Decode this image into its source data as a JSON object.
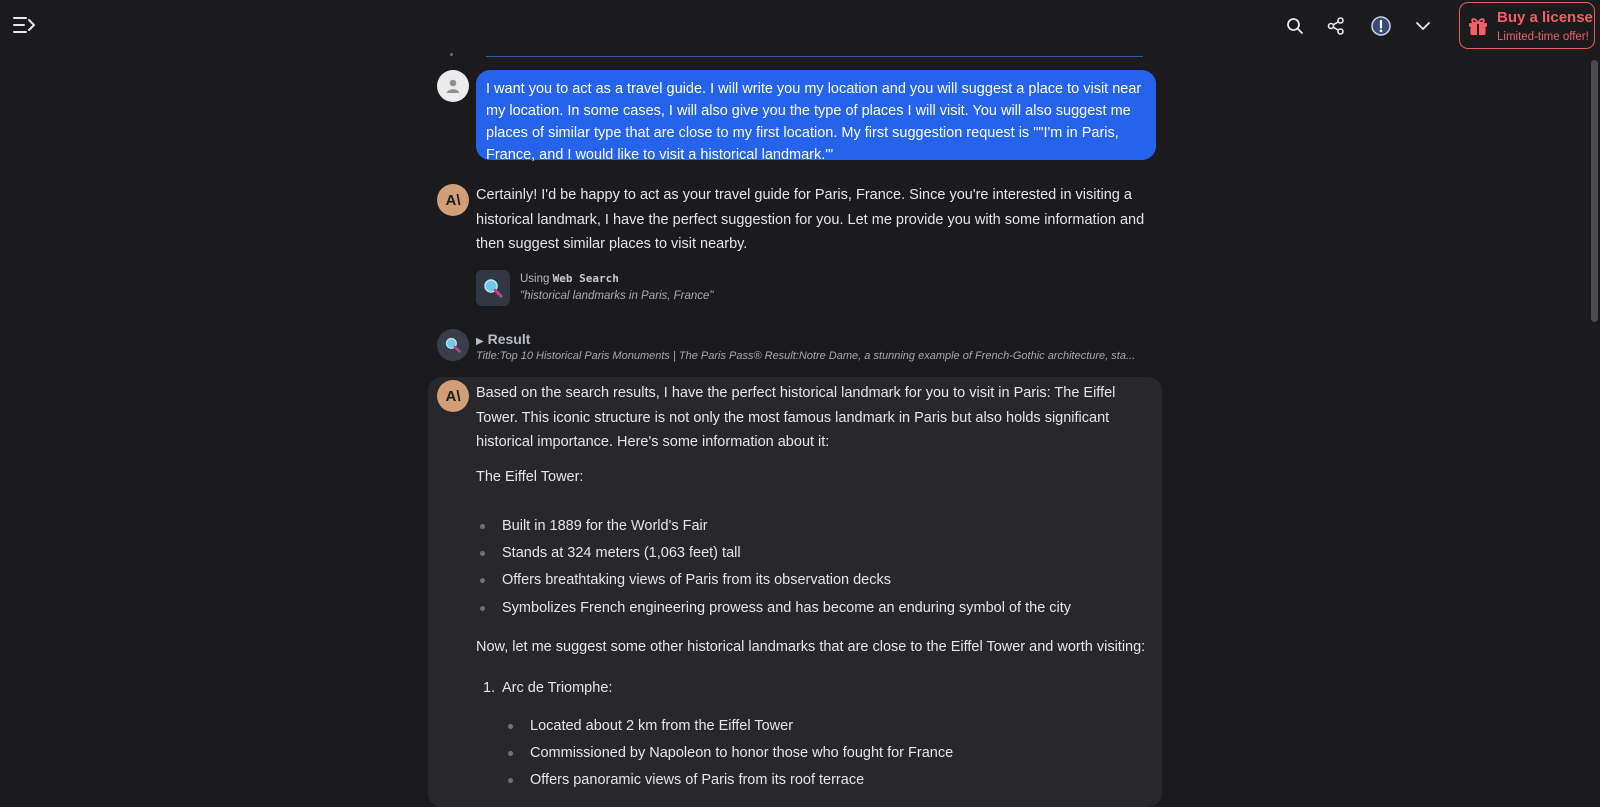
{
  "header": {
    "menu_icon": "sidebar-toggle-icon",
    "icons": [
      "search-icon",
      "share-icon",
      "alert-icon",
      "chevron-down-icon"
    ],
    "buy": {
      "title": "Buy a license",
      "subtitle": "Limited-time offer!",
      "icon": "gift-icon",
      "color": "#f35f66"
    }
  },
  "colors": {
    "background": "#1b1b1d",
    "user_bubble": "#2563eb",
    "ai_panel": "#28282c",
    "ai_avatar": "#d19e78"
  },
  "messages": {
    "user": {
      "text": "I want you to act as a travel guide. I will write you my location and you will suggest a place to visit near my location. In some cases, I will also give you the type of places I will visit. You will also suggest me places of similar type that are close to my first location. My first suggestion request is \"\"I'm in Paris, France, and I would like to visit a historical landmark.'\""
    },
    "ai_first": {
      "avatar_label": "A\\",
      "text": "Certainly! I'd be happy to act as your travel guide for Paris, France. Since you're interested in visiting a historical landmark, I have the perfect suggestion for you. Let me provide you with some information and then suggest similar places to visit nearby."
    },
    "tool": {
      "using_prefix": "Using",
      "tool_name": "Web Search",
      "query": "\"historical landmarks in Paris, France\""
    },
    "result": {
      "toggle_label": "Result",
      "snippet": "Title:Top 10 Historical Paris Monuments | The Paris Pass® Result:Notre Dame, a stunning example of French-Gothic architecture, sta..."
    },
    "ai_second": {
      "avatar_label": "A\\",
      "intro": "Based on the search results, I have the perfect historical landmark for you to visit in Paris: The Eiffel Tower. This iconic structure is not only the most famous landmark in Paris but also holds significant historical importance. Here's some information about it:",
      "heading": "The Eiffel Tower:",
      "facts": [
        "Built in 1889 for the World's Fair",
        "Stands at 324 meters (1,063 feet) tall",
        "Offers breathtaking views of Paris from its observation decks",
        "Symbolizes French engineering prowess and has become an enduring symbol of the city"
      ],
      "transition": "Now, let me suggest some other historical landmarks that are close to the Eiffel Tower and worth visiting:",
      "places": [
        {
          "number": "1.",
          "name": "Arc de Triomphe:",
          "details": [
            "Located about 2 km from the Eiffel Tower",
            "Commissioned by Napoleon to honor those who fought for France",
            "Offers panoramic views of Paris from its roof terrace"
          ]
        }
      ]
    }
  }
}
